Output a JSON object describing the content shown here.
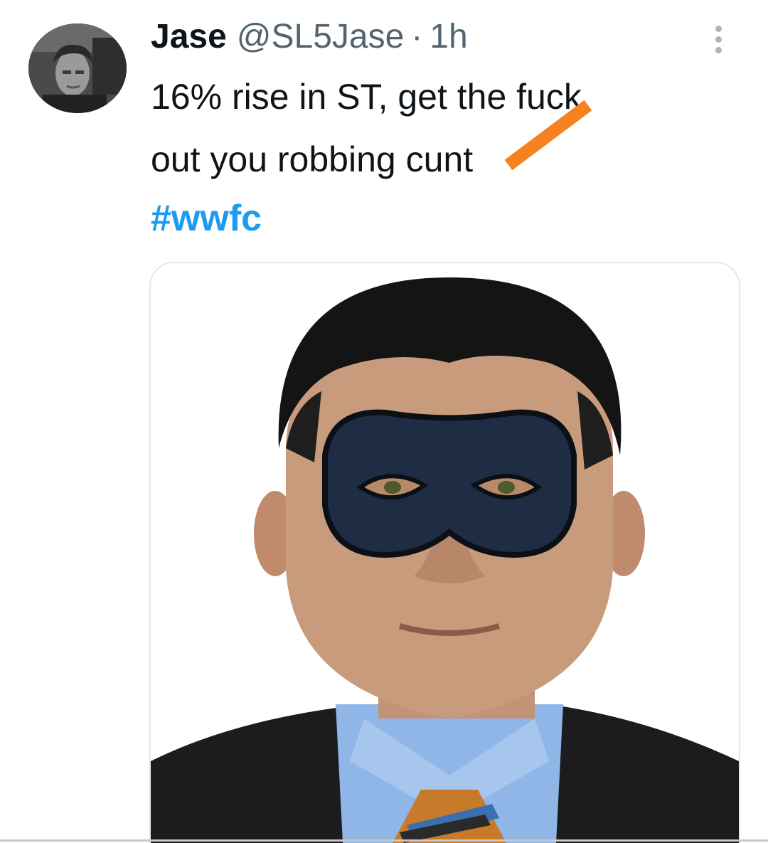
{
  "tweet": {
    "display_name": "Jase",
    "handle": "@SL5Jase",
    "separator": "·",
    "timestamp": "1h",
    "text_line1": "16% rise in ST, get the fuck",
    "text_line2": "out you robbing cunt",
    "hashtag": "#wwfc",
    "more_icon": "more-vertical-icon",
    "colors": {
      "hashtag": "#1d9bf0",
      "secondary_text": "#536471",
      "censor_mark": "#f5821f",
      "mask": "#1e2d44"
    }
  }
}
